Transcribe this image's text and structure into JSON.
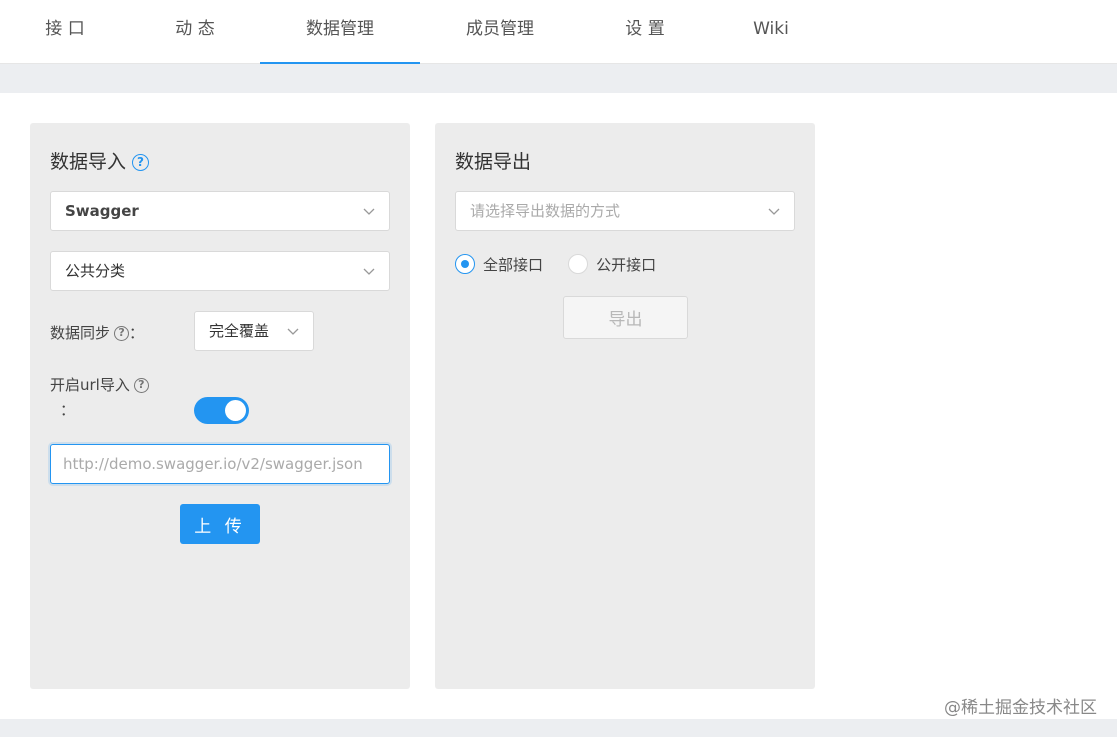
{
  "nav": {
    "tabs": [
      {
        "label": "接 口"
      },
      {
        "label": "动 态"
      },
      {
        "label": "数据管理"
      },
      {
        "label": "成员管理"
      },
      {
        "label": "设 置"
      },
      {
        "label": "Wiki"
      }
    ],
    "active_index": 2
  },
  "import_panel": {
    "title": "数据导入",
    "help_glyph": "?",
    "type_select": {
      "value": "Swagger"
    },
    "category_select": {
      "value": "公共分类"
    },
    "sync_label": "数据同步",
    "sync_colon": "：",
    "sync_select": {
      "value": "完全覆盖"
    },
    "url_label": "开启url导入",
    "url_colon": "：",
    "url_toggle_on": true,
    "url_input": {
      "value": "",
      "placeholder": "http://demo.swagger.io/v2/swagger.json"
    },
    "upload_button": "上 传"
  },
  "export_panel": {
    "title": "数据导出",
    "method_select": {
      "placeholder": "请选择导出数据的方式"
    },
    "radios": [
      {
        "label": "全部接口",
        "checked": true
      },
      {
        "label": "公开接口",
        "checked": false
      }
    ],
    "export_button": "导出"
  },
  "watermark": "@稀土掘金技术社区",
  "colors": {
    "accent": "#2395f1",
    "panel_bg": "#ececec",
    "band_bg": "#eceef1"
  }
}
